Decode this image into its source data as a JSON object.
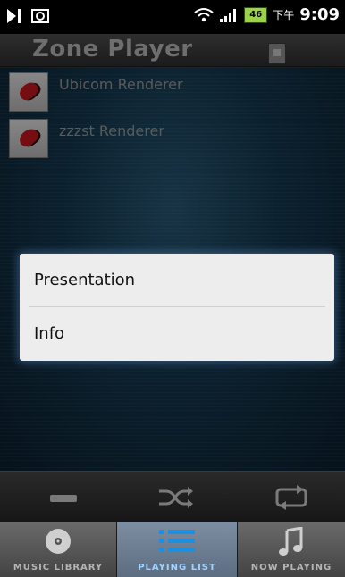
{
  "status_bar": {
    "battery": "46",
    "ampm": "下午",
    "time": "9:09"
  },
  "header": {
    "title": "Zone Player"
  },
  "renderers": [
    {
      "name": "Ubicom Renderer",
      "icon": "sonos-speaker-icon"
    },
    {
      "name": "zzzst Renderer",
      "icon": "sonos-speaker-icon"
    }
  ],
  "dialog": {
    "items": [
      "Presentation",
      "Info"
    ]
  },
  "controls": {
    "icons": [
      "minus-icon",
      "shuffle-icon",
      "repeat-icon"
    ]
  },
  "tabs": [
    {
      "label": "MUSIC LIBRARY",
      "icon": "vinyl-disc-icon",
      "active": false
    },
    {
      "label": "PLAYING LIST",
      "icon": "list-icon",
      "active": true
    },
    {
      "label": "NOW PLAYING",
      "icon": "music-note-icon",
      "active": false
    }
  ],
  "colors": {
    "tab_active_text": "#9ed4ff",
    "renderer_icon_red": "#b2161c",
    "dialog_bg": "#ededed"
  }
}
